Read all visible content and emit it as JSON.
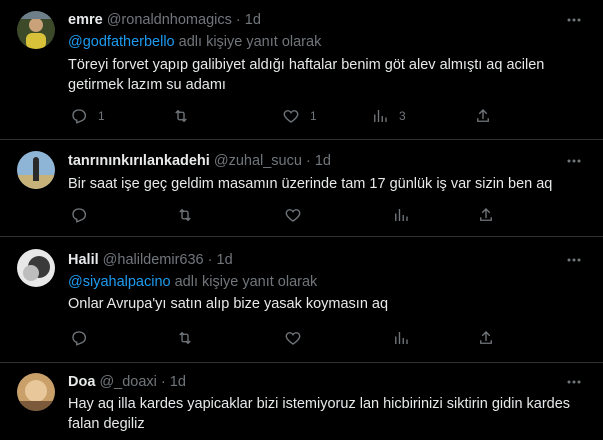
{
  "tweets": [
    {
      "name": "emre",
      "handle": "@ronaldnhomagics",
      "sep": "·",
      "time": "1d",
      "reply_prefix": "",
      "reply_handle": "@godfatherbello",
      "reply_suffix": " adlı kişiye yanıt olarak",
      "text": "Töreyi forvet yapıp galibiyet aldığı haftalar benim göt alev almıştı aq acilen getirmek lazım su adamı",
      "replies": "1",
      "retweets": "",
      "likes": "1",
      "views": "3",
      "avatar_color": "#5c6b3a"
    },
    {
      "name": "tanrınınkırılankadehi",
      "handle": "@zuhal_sucu",
      "sep": "·",
      "time": "1d",
      "text": "Bir saat işe geç geldim masamın üzerinde tam 17 günlük iş var sizin ben aq",
      "replies": "",
      "retweets": "",
      "likes": "",
      "views": "",
      "avatar_color": "#4a7fb0"
    },
    {
      "name": "Halil",
      "handle": "@halildemir636",
      "sep": "·",
      "time": "1d",
      "reply_handle": "@siyahalpacino",
      "reply_suffix": " adlı kişiye yanıt olarak",
      "text": "Onlar Avrupa'yı satın alıp bize yasak koymasın aq",
      "replies": "",
      "retweets": "",
      "likes": "",
      "views": "",
      "avatar_color": "#9a9a9a"
    },
    {
      "name": "Doa",
      "handle": "@_doaxi",
      "sep": "·",
      "time": "1d",
      "text": "Hay aq illa kardes yapicaklar bizi istemiyoruz lan hicbirinizi siktirin gidin kardes falan degiliz",
      "avatar_color": "#b08a5a"
    }
  ]
}
